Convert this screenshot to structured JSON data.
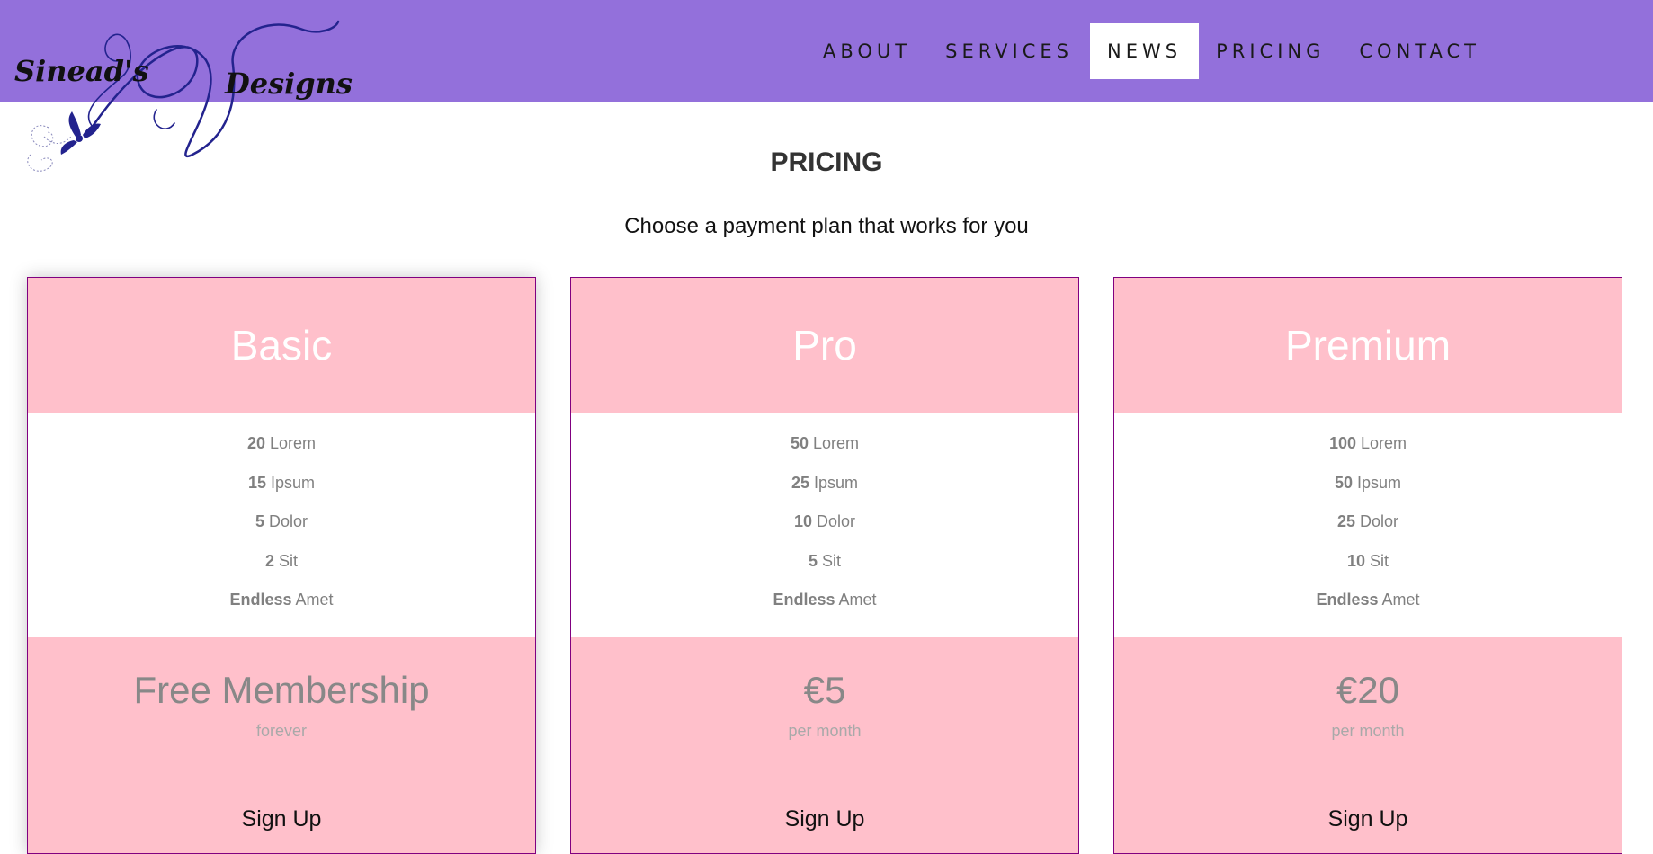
{
  "brand": {
    "left_text": "Sinead's",
    "right_text": "Designs"
  },
  "nav": {
    "items": [
      {
        "label": "ABOUT"
      },
      {
        "label": "SERVICES"
      },
      {
        "label": "NEWS"
      },
      {
        "label": "PRICING"
      },
      {
        "label": "CONTACT"
      }
    ],
    "active": "NEWS"
  },
  "section": {
    "title": "PRICING",
    "subtitle": "Choose a payment plan that works for you"
  },
  "plans": [
    {
      "name": "Basic",
      "features": [
        {
          "value": "20",
          "label": "Lorem"
        },
        {
          "value": "15",
          "label": "Ipsum"
        },
        {
          "value": "5",
          "label": "Dolor"
        },
        {
          "value": "2",
          "label": "Sit"
        },
        {
          "value": "Endless",
          "label": "Amet"
        }
      ],
      "price": "Free Membership",
      "period": "forever",
      "cta": "Sign Up"
    },
    {
      "name": "Pro",
      "features": [
        {
          "value": "50",
          "label": "Lorem"
        },
        {
          "value": "25",
          "label": "Ipsum"
        },
        {
          "value": "10",
          "label": "Dolor"
        },
        {
          "value": "5",
          "label": "Sit"
        },
        {
          "value": "Endless",
          "label": "Amet"
        }
      ],
      "price": "€5",
      "period": "per month",
      "cta": "Sign Up"
    },
    {
      "name": "Premium",
      "features": [
        {
          "value": "100",
          "label": "Lorem"
        },
        {
          "value": "50",
          "label": "Ipsum"
        },
        {
          "value": "25",
          "label": "Dolor"
        },
        {
          "value": "10",
          "label": "Sit"
        },
        {
          "value": "Endless",
          "label": "Amet"
        }
      ],
      "price": "€20",
      "period": "per month",
      "cta": "Sign Up"
    }
  ],
  "colors": {
    "navbar_bg": "#9370db",
    "card_accent": "#ffc0cb",
    "card_border": "#800080",
    "logo_ink": "#23238e"
  }
}
